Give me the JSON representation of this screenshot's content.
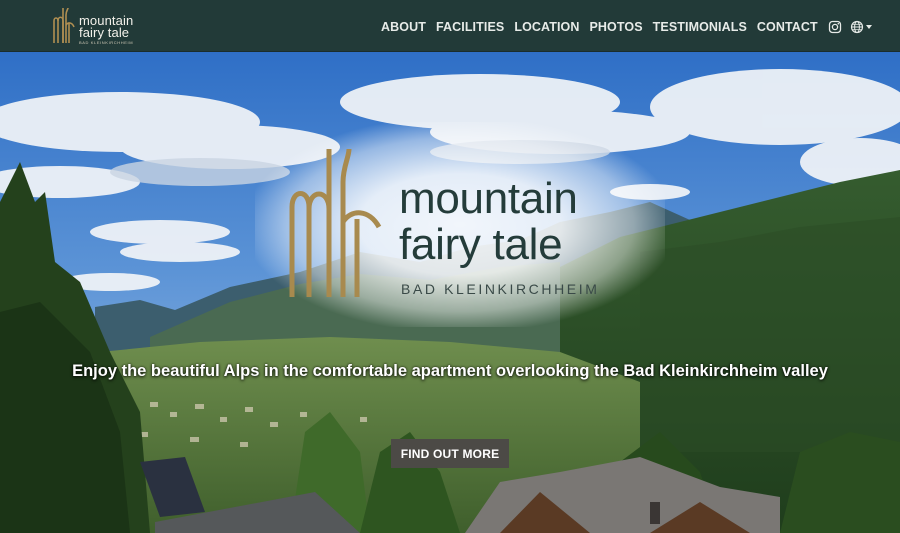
{
  "brand": {
    "line1": "mountain",
    "line2": "fairy tale",
    "line3": "BAD KLEINKIRCHHEIM"
  },
  "nav": {
    "items": [
      {
        "label": "ABOUT"
      },
      {
        "label": "FACILITIES"
      },
      {
        "label": "LOCATION"
      },
      {
        "label": "PHOTOS"
      },
      {
        "label": "TESTIMONIALS"
      },
      {
        "label": "CONTACT"
      }
    ],
    "icons": [
      "instagram-icon",
      "globe-icon",
      "chevron-down-icon"
    ]
  },
  "hero": {
    "logo_line1": "mountain",
    "logo_line2": "fairy tale",
    "logo_line3": "BAD KLEINKIRCHHEIM",
    "tagline": "Enjoy the beautiful Alps in the comfortable apartment overlooking the Bad Kleinkirchheim valley",
    "cta_label": "FIND OUT MORE"
  },
  "colors": {
    "navbar": "#223a38",
    "logo_gold": "#a88a4e",
    "logo_text": "#243c3a",
    "cta": "#4c4a46"
  }
}
